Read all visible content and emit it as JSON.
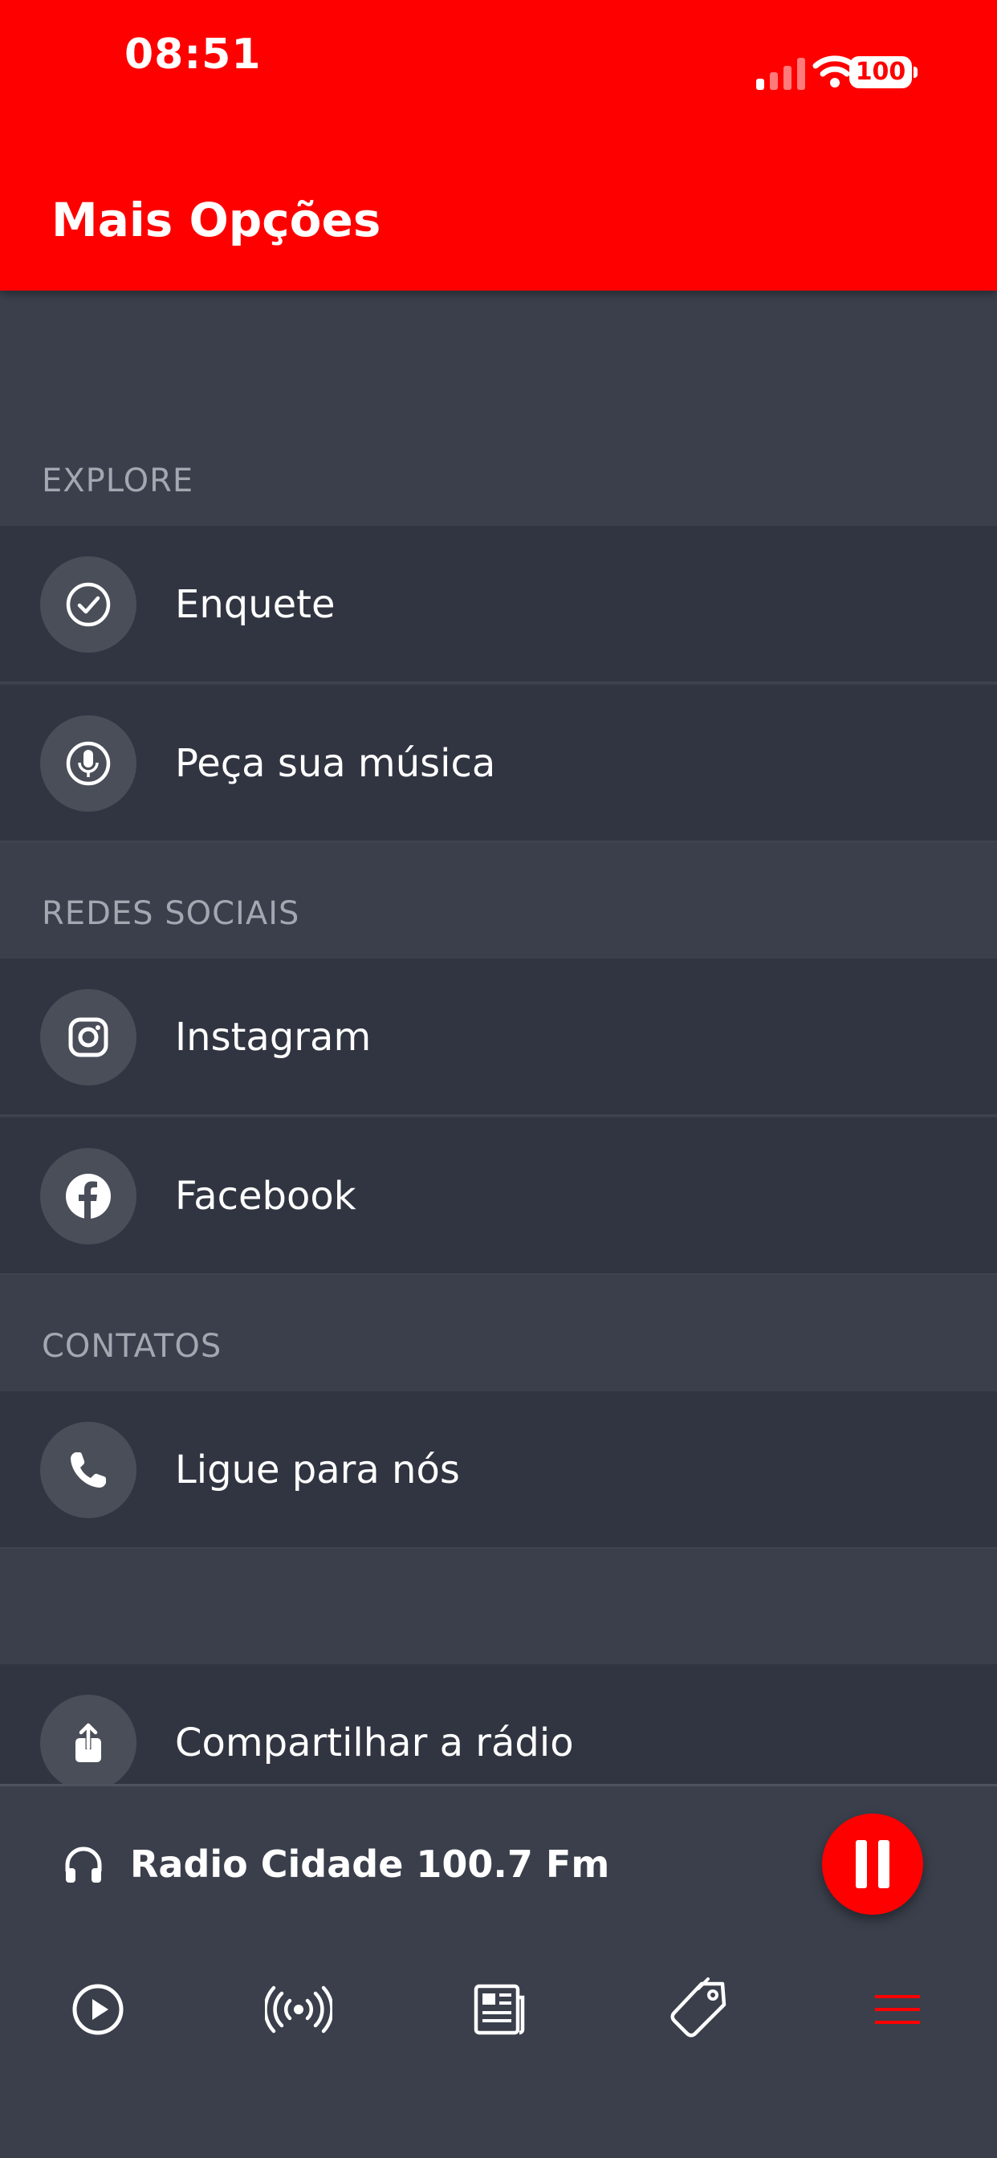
{
  "status_bar": {
    "time": "08:51",
    "battery": "100",
    "icons": [
      "signal-icon",
      "wifi-icon",
      "battery-icon"
    ]
  },
  "header": {
    "title": "Mais Opções",
    "background": "#ff0000"
  },
  "sections": {
    "explore": {
      "label": "EXPLORE",
      "items": [
        {
          "label": "Enquete",
          "icon": "check-circle-icon"
        },
        {
          "label": "Peça sua música",
          "icon": "microphone-icon"
        }
      ]
    },
    "social": {
      "label": "REDES SOCIAIS",
      "items": [
        {
          "label": "Instagram",
          "icon": "instagram-icon"
        },
        {
          "label": "Facebook",
          "icon": "facebook-icon"
        }
      ]
    },
    "contacts": {
      "label": "CONTATOS",
      "items": [
        {
          "label": "Ligue para nós",
          "icon": "phone-icon"
        }
      ]
    },
    "share": {
      "label": "Compartilhar a rádio",
      "icon": "share-icon"
    }
  },
  "player": {
    "station": "Radio Cidade 100.7 Fm",
    "state": "playing",
    "accent": "#ff0000"
  },
  "bottom_nav": {
    "items": [
      {
        "name": "play",
        "icon": "play-circle-icon"
      },
      {
        "name": "broadcast",
        "icon": "broadcast-icon"
      },
      {
        "name": "news",
        "icon": "newspaper-icon"
      },
      {
        "name": "promotions",
        "icon": "tag-icon"
      },
      {
        "name": "more",
        "icon": "menu-icon",
        "active": true
      }
    ]
  }
}
